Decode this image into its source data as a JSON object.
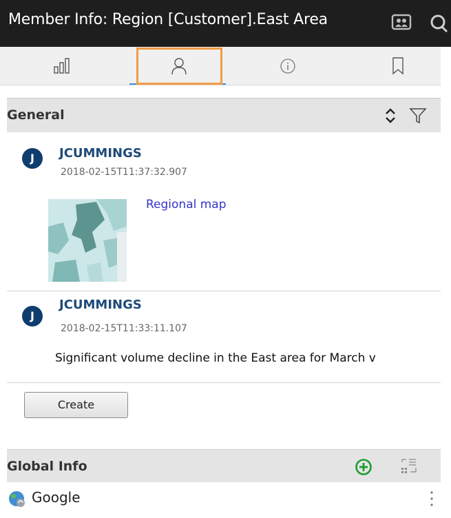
{
  "window": {
    "title": "Member Info: Region [Customer].East Area"
  },
  "tabs": [
    {
      "name": "chart-tab",
      "icon": "bar-chart-icon"
    },
    {
      "name": "member-tab",
      "icon": "person-icon",
      "active": true
    },
    {
      "name": "info-tab",
      "icon": "info-icon"
    },
    {
      "name": "bookmark-tab",
      "icon": "bookmark-icon"
    }
  ],
  "general": {
    "title": "General",
    "comments": [
      {
        "avatar_letter": "J",
        "author": "JCUMMINGS",
        "timestamp": "2018-02-15T11:37:32.907",
        "link_text": "Regional map"
      },
      {
        "avatar_letter": "J",
        "author": "JCUMMINGS",
        "timestamp": "2018-02-15T11:33:11.107",
        "text": "Significant volume decline in the East area for March v"
      }
    ],
    "create_label": "Create"
  },
  "global_info": {
    "title": "Global Info",
    "items": [
      {
        "label": "Google",
        "icon": "globe-icon"
      }
    ]
  },
  "colors": {
    "titlebar_bg": "#1e1e1e",
    "accent_blue": "#3c8fd6",
    "tab_highlight": "#f29b45",
    "avatar_bg": "#0f3d6e",
    "author_color": "#1d4a78",
    "link_color": "#3333cc",
    "add_green": "#1e9c2f"
  }
}
